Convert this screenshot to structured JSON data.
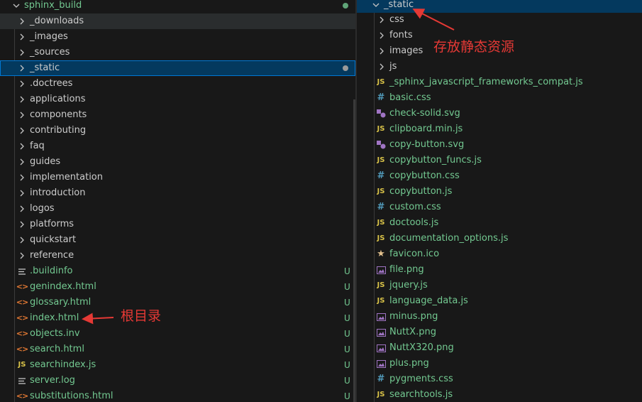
{
  "left": {
    "root": "sphinx_build",
    "rows": [
      {
        "name": "_downloads",
        "kind": "folder"
      },
      {
        "name": "_images",
        "kind": "folder"
      },
      {
        "name": "_sources",
        "kind": "folder"
      },
      {
        "name": "_static",
        "kind": "folder"
      },
      {
        "name": ".doctrees",
        "kind": "folder"
      },
      {
        "name": "applications",
        "kind": "folder"
      },
      {
        "name": "components",
        "kind": "folder"
      },
      {
        "name": "contributing",
        "kind": "folder"
      },
      {
        "name": "faq",
        "kind": "folder"
      },
      {
        "name": "guides",
        "kind": "folder"
      },
      {
        "name": "implementation",
        "kind": "folder"
      },
      {
        "name": "introduction",
        "kind": "folder"
      },
      {
        "name": "logos",
        "kind": "folder"
      },
      {
        "name": "platforms",
        "kind": "folder"
      },
      {
        "name": "quickstart",
        "kind": "folder"
      },
      {
        "name": "reference",
        "kind": "folder"
      },
      {
        "name": ".buildinfo",
        "kind": "file",
        "icon": "text-lines-icon",
        "status": "U"
      },
      {
        "name": "genindex.html",
        "kind": "file",
        "icon": "html-icon",
        "status": "U"
      },
      {
        "name": "glossary.html",
        "kind": "file",
        "icon": "html-icon",
        "status": "U"
      },
      {
        "name": "index.html",
        "kind": "file",
        "icon": "html-icon",
        "status": "U"
      },
      {
        "name": "objects.inv",
        "kind": "file",
        "icon": "html-icon",
        "status": "U"
      },
      {
        "name": "search.html",
        "kind": "file",
        "icon": "html-icon",
        "status": "U"
      },
      {
        "name": "searchindex.js",
        "kind": "file",
        "icon": "js-icon",
        "status": "U"
      },
      {
        "name": "server.log",
        "kind": "file",
        "icon": "text-lines-icon",
        "status": "U"
      },
      {
        "name": "substitutions.html",
        "kind": "file",
        "icon": "html-icon",
        "status": "U"
      }
    ],
    "annotation": "根目录"
  },
  "right": {
    "root": "_static",
    "rows": [
      {
        "name": "css",
        "kind": "folder"
      },
      {
        "name": "fonts",
        "kind": "folder"
      },
      {
        "name": "images",
        "kind": "folder"
      },
      {
        "name": "js",
        "kind": "folder"
      },
      {
        "name": "_sphinx_javascript_frameworks_compat.js",
        "kind": "file",
        "icon": "js-icon"
      },
      {
        "name": "basic.css",
        "kind": "file",
        "icon": "css-icon"
      },
      {
        "name": "check-solid.svg",
        "kind": "file",
        "icon": "svg-icon"
      },
      {
        "name": "clipboard.min.js",
        "kind": "file",
        "icon": "js-icon"
      },
      {
        "name": "copy-button.svg",
        "kind": "file",
        "icon": "svg-icon"
      },
      {
        "name": "copybutton_funcs.js",
        "kind": "file",
        "icon": "js-icon"
      },
      {
        "name": "copybutton.css",
        "kind": "file",
        "icon": "css-icon"
      },
      {
        "name": "copybutton.js",
        "kind": "file",
        "icon": "js-icon"
      },
      {
        "name": "custom.css",
        "kind": "file",
        "icon": "css-icon"
      },
      {
        "name": "doctools.js",
        "kind": "file",
        "icon": "js-icon"
      },
      {
        "name": "documentation_options.js",
        "kind": "file",
        "icon": "js-icon"
      },
      {
        "name": "favicon.ico",
        "kind": "file",
        "icon": "star-icon"
      },
      {
        "name": "file.png",
        "kind": "file",
        "icon": "image-icon"
      },
      {
        "name": "jquery.js",
        "kind": "file",
        "icon": "js-icon"
      },
      {
        "name": "language_data.js",
        "kind": "file",
        "icon": "js-icon"
      },
      {
        "name": "minus.png",
        "kind": "file",
        "icon": "image-icon"
      },
      {
        "name": "NuttX.png",
        "kind": "file",
        "icon": "image-icon"
      },
      {
        "name": "NuttX320.png",
        "kind": "file",
        "icon": "image-icon"
      },
      {
        "name": "plus.png",
        "kind": "file",
        "icon": "image-icon"
      },
      {
        "name": "pygments.css",
        "kind": "file",
        "icon": "css-icon"
      },
      {
        "name": "searchtools.js",
        "kind": "file",
        "icon": "js-icon"
      }
    ],
    "annotation": "存放静态资源"
  },
  "colors": {
    "untracked": "#73c991",
    "annotation": "#e53935",
    "selection": "#04395e",
    "focus": "#0078d4"
  }
}
